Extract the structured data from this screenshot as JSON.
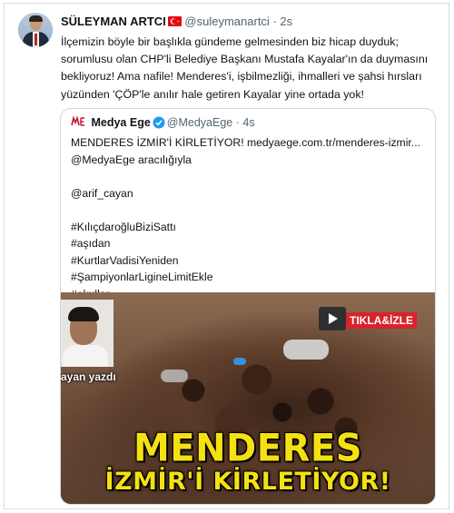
{
  "tweet": {
    "author_name": "SÜLEYMAN ARTCI",
    "author_handle": "@suleymanartci",
    "separator": "·",
    "time": "2s",
    "text_lines": [
      "İlçemizin böyle bir başlıkla gündeme gelmesinden biz hicap duyduk;",
      "sorumlusu olan CHP'li Belediye Başkanı Mustafa Kayalar'ın da duymasını",
      "bekliyoruz! Ama nafile! Menderes'i, işbilmezliği, ihmalleri ve şahsi hırsları",
      "yüzünden 'ÇÖP'le anılır hale getiren Kayalar yine ortada yok!"
    ],
    "flag_icon": "turkey-flag-icon"
  },
  "quote": {
    "author_name": "Medya Ege",
    "author_handle": "@MedyaEge",
    "separator": "·",
    "time": "4s",
    "verified_color": "#1d9bf0",
    "lines": [
      "MENDERES İZMİR'İ KİRLETİYOR! medyaege.com.tr/menderes-izmir...",
      "@MedyaEge aracılığıyla",
      "",
      "@arif_cayan",
      "",
      "#KılıçdaroğluBiziSattı",
      "#aşıdan",
      "#KurtlarVadisiYeniden",
      "#ŞampiyonlarLigineLimitEkle",
      "#okullar"
    ],
    "media": {
      "inset_caption": "ayan yazdı",
      "watch_label": "TIKLA&İZLE",
      "headline_line1": "MENDERES",
      "headline_line2": "İZMİR'İ KİRLETİYOR!",
      "headline_color": "#f5e012"
    }
  }
}
